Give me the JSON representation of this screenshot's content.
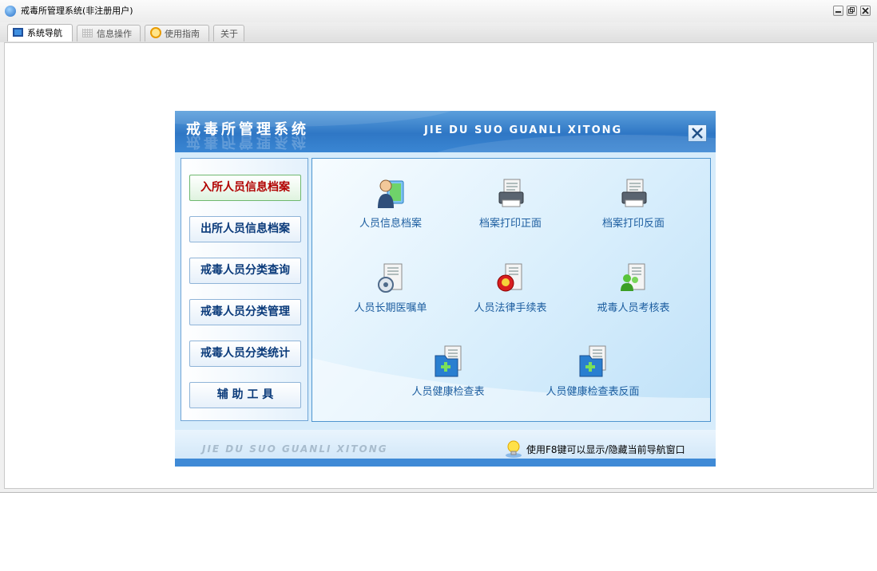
{
  "window": {
    "title": "戒毒所管理系统(非注册用户)",
    "controls": [
      "minimize",
      "restore",
      "close"
    ]
  },
  "tabs": [
    {
      "label": "系统导航",
      "icon": "monitor-icon",
      "active": true
    },
    {
      "label": "信息操作",
      "icon": "grid-icon",
      "active": false
    },
    {
      "label": "使用指南",
      "icon": "guide-icon",
      "active": false
    },
    {
      "label": "关于",
      "icon": "",
      "active": false
    }
  ],
  "panel": {
    "title": "戒毒所管理系统",
    "subtitle": "JIE DU SUO GUANLI XITONG",
    "nav": [
      {
        "label": "入所人员信息档案",
        "active": true
      },
      {
        "label": "出所人员信息档案",
        "active": false
      },
      {
        "label": "戒毒人员分类查询",
        "active": false
      },
      {
        "label": "戒毒人员分类管理",
        "active": false
      },
      {
        "label": "戒毒人员分类统计",
        "active": false
      },
      {
        "label": "辅 助 工 具",
        "active": false
      }
    ],
    "items": [
      {
        "label": "人员信息档案",
        "icon": "person-file-icon"
      },
      {
        "label": "档案打印正面",
        "icon": "printer-icon"
      },
      {
        "label": "档案打印反面",
        "icon": "printer-icon"
      },
      {
        "label": "人员长期医嘱单",
        "icon": "stethoscope-doc-icon"
      },
      {
        "label": "人员法律手续表",
        "icon": "emblem-doc-icon"
      },
      {
        "label": "戒毒人员考核表",
        "icon": "users-doc-icon"
      },
      {
        "label": "人员健康检查表",
        "icon": "health-folder-icon"
      },
      {
        "label": "人员健康检查表反面",
        "icon": "health-folder-icon"
      }
    ],
    "footer": {
      "text": "JIE DU SUO GUANLI XITONG",
      "hint": "使用F8键可以显示/隐藏当前导航窗口",
      "hint_icon": "lightbulb-icon"
    }
  },
  "colors": {
    "banner_blue": "#2f77c5",
    "nav_text": "#0a3a7a",
    "nav_active_text": "#b10000",
    "item_text": "#1d5ea0"
  }
}
